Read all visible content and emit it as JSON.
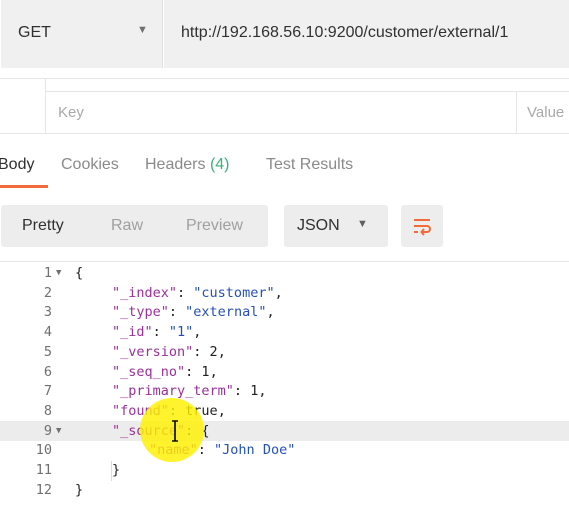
{
  "request": {
    "method": "GET",
    "url": "http://192.168.56.10:9200/customer/external/1"
  },
  "params": {
    "key_placeholder": "Key",
    "value_placeholder": "Value"
  },
  "response_tabs": [
    {
      "label": "Body"
    },
    {
      "label": "Cookies"
    },
    {
      "label": "Headers",
      "count": "(4)"
    },
    {
      "label": "Test Results"
    }
  ],
  "view_modes": [
    "Pretty",
    "Raw",
    "Preview"
  ],
  "format": "JSON",
  "colors": {
    "accent": "#f26b3a",
    "count_green": "#3ab27a",
    "json_key": "#9b2f9b",
    "json_string": "#2450b8",
    "cursor_highlight": "#fff000"
  },
  "icons": [
    "chevron-down-icon",
    "wrap-lines-icon",
    "fold-arrow-icon",
    "text-cursor-icon"
  ],
  "code_lines": [
    {
      "n": "1",
      "fold": true,
      "indent": 0,
      "parts": [
        [
          "p",
          "{"
        ]
      ]
    },
    {
      "n": "2",
      "indent": 1,
      "parts": [
        [
          "k",
          "\"_index\""
        ],
        [
          "p",
          ": "
        ],
        [
          "s",
          "\"customer\""
        ],
        [
          "p",
          ","
        ]
      ]
    },
    {
      "n": "3",
      "indent": 1,
      "parts": [
        [
          "k",
          "\"_type\""
        ],
        [
          "p",
          ": "
        ],
        [
          "s",
          "\"external\""
        ],
        [
          "p",
          ","
        ]
      ]
    },
    {
      "n": "4",
      "indent": 1,
      "parts": [
        [
          "k",
          "\"_id\""
        ],
        [
          "p",
          ": "
        ],
        [
          "s",
          "\"1\""
        ],
        [
          "p",
          ","
        ]
      ]
    },
    {
      "n": "5",
      "indent": 1,
      "parts": [
        [
          "k",
          "\"_version\""
        ],
        [
          "p",
          ": "
        ],
        [
          "n",
          "2"
        ],
        [
          "p",
          ","
        ]
      ]
    },
    {
      "n": "6",
      "indent": 1,
      "parts": [
        [
          "k",
          "\"_seq_no\""
        ],
        [
          "p",
          ": "
        ],
        [
          "n",
          "1"
        ],
        [
          "p",
          ","
        ]
      ]
    },
    {
      "n": "7",
      "indent": 1,
      "parts": [
        [
          "k",
          "\"_primary_term\""
        ],
        [
          "p",
          ": "
        ],
        [
          "n",
          "1"
        ],
        [
          "p",
          ","
        ]
      ]
    },
    {
      "n": "8",
      "indent": 1,
      "parts": [
        [
          "k",
          "\"found\""
        ],
        [
          "p",
          ": "
        ],
        [
          "n",
          "true"
        ],
        [
          "p",
          ","
        ]
      ]
    },
    {
      "n": "9",
      "fold": true,
      "highlight": true,
      "indent": 1,
      "parts": [
        [
          "k",
          "\"_source\""
        ],
        [
          "p",
          ": {"
        ]
      ]
    },
    {
      "n": "10",
      "indent": 2,
      "parts": [
        [
          "k",
          "\"name\""
        ],
        [
          "p",
          ": "
        ],
        [
          "s",
          "\"John Doe\""
        ]
      ]
    },
    {
      "n": "11",
      "indent": 1,
      "parts": [
        [
          "p",
          "}"
        ]
      ]
    },
    {
      "n": "12",
      "indent": 0,
      "parts": [
        [
          "p",
          "}"
        ]
      ]
    }
  ]
}
